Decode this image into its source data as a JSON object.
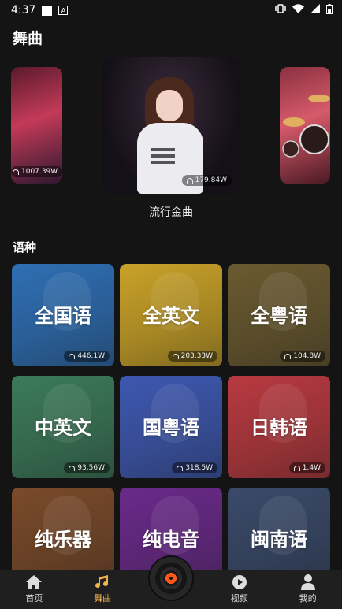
{
  "status": {
    "time": "4:37"
  },
  "page": {
    "title": "舞曲"
  },
  "carousel": {
    "items": [
      {
        "count": "1007.39W"
      },
      {
        "count": "179.84W",
        "caption": "流行金曲"
      },
      {
        "count": ""
      }
    ]
  },
  "section": {
    "title": "语种"
  },
  "tiles": [
    {
      "label": "全国语",
      "count": "446.1W",
      "color": "#2f6fb4"
    },
    {
      "label": "全英文",
      "count": "203.33W",
      "color": "#c9a228"
    },
    {
      "label": "全粤语",
      "count": "104.8W",
      "color": "#6a5a30"
    },
    {
      "label": "中英文",
      "count": "93.56W",
      "color": "#3c7a5a"
    },
    {
      "label": "国粤语",
      "count": "318.5W",
      "color": "#3e58b0"
    },
    {
      "label": "日韩语",
      "count": "1.4W",
      "color": "#b83a40"
    },
    {
      "label": "纯乐器",
      "count": "",
      "color": "#7a4a2a"
    },
    {
      "label": "纯电音",
      "count": "",
      "color": "#6a2a8a"
    },
    {
      "label": "闽南语",
      "count": "",
      "color": "#3a4a6a"
    }
  ],
  "tabbar": {
    "tabs": [
      {
        "label": "首页",
        "icon": "home-icon"
      },
      {
        "label": "舞曲",
        "icon": "music-note-icon",
        "active": true
      },
      {
        "label": "视频",
        "icon": "video-icon"
      },
      {
        "label": "我的",
        "icon": "user-icon"
      }
    ],
    "center_icon": "vinyl-record-icon"
  },
  "colors": {
    "accent": "#f3b14c",
    "background": "#141414",
    "tabbar": "#1f1f1f"
  }
}
